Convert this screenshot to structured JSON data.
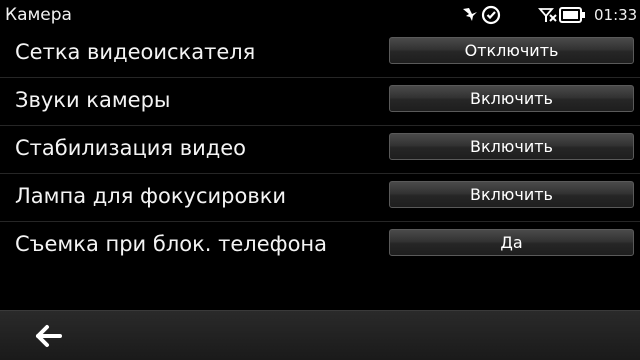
{
  "status_bar": {
    "app_title": "Камера",
    "time": "01:33",
    "icons": [
      "notification-icon",
      "clock-alarm-icon",
      "no-signal-icon",
      "battery-icon"
    ]
  },
  "settings": [
    {
      "label": "Сетка видеоискателя",
      "value": "Отключить"
    },
    {
      "label": "Звуки камеры",
      "value": "Включить"
    },
    {
      "label": "Стабилизация видео",
      "value": "Включить"
    },
    {
      "label": "Лампа для фокусировки",
      "value": "Включить"
    },
    {
      "label": "Съемка при блок. телефона",
      "value": "Да"
    }
  ],
  "toolbar": {
    "back_icon": "back-arrow-icon"
  },
  "colors": {
    "background": "#000000",
    "text": "#f4f4f4",
    "button_border": "#5a5a5a",
    "toolbar": "#1f1f1f"
  }
}
